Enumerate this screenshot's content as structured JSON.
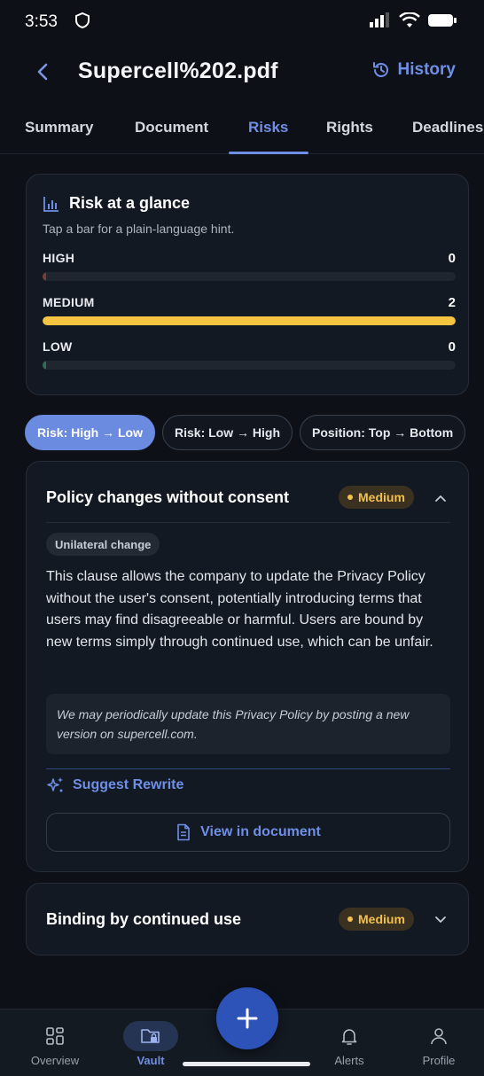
{
  "status_bar": {
    "time": "3:53"
  },
  "header": {
    "title": "Supercell%202.pdf",
    "history_label": "History"
  },
  "tabs": [
    {
      "label": "Summary",
      "active": false
    },
    {
      "label": "Document",
      "active": false
    },
    {
      "label": "Risks",
      "active": true
    },
    {
      "label": "Rights",
      "active": false
    },
    {
      "label": "Deadlines",
      "active": false
    }
  ],
  "glance": {
    "title": "Risk at a glance",
    "hint": "Tap a bar for a plain-language hint.",
    "bars": [
      {
        "label": "HIGH",
        "count": "0",
        "fraction": 0,
        "color": "#7a3b3b"
      },
      {
        "label": "MEDIUM",
        "count": "2",
        "fraction": 1,
        "color": "#f5c542"
      },
      {
        "label": "LOW",
        "count": "0",
        "fraction": 0,
        "color": "#2f6b55"
      }
    ]
  },
  "sort_chips": [
    {
      "label": "Risk: High → Low",
      "active": true
    },
    {
      "label": "Risk: Low → High",
      "active": false
    },
    {
      "label": "Position: Top → Bottom",
      "active": false
    }
  ],
  "risks": [
    {
      "title": "Policy changes without consent",
      "severity": "Medium",
      "expanded": true,
      "tag": "Unilateral change",
      "description": "This clause allows the company to update the Privacy Policy without the user's consent, potentially introducing terms that users may find disagreeable or harmful. Users are bound by new terms simply through continued use, which can be unfair.",
      "quote": "We may periodically update this Privacy Policy by posting a new  version on supercell.com.",
      "suggest_label": "Suggest Rewrite",
      "view_label": "View in document"
    },
    {
      "title": "Binding by continued use",
      "severity": "Medium",
      "expanded": false
    }
  ],
  "bottom_nav": [
    {
      "label": "Overview",
      "icon": "grid-icon",
      "active": false
    },
    {
      "label": "Vault",
      "icon": "folder-lock-icon",
      "active": true
    },
    {
      "label": "Alerts",
      "icon": "bell-icon",
      "active": false
    },
    {
      "label": "Profile",
      "icon": "person-icon",
      "active": false
    }
  ],
  "colors": {
    "accent": "#6f8fe6",
    "medium": "#f5c542",
    "background": "#0d1117"
  }
}
